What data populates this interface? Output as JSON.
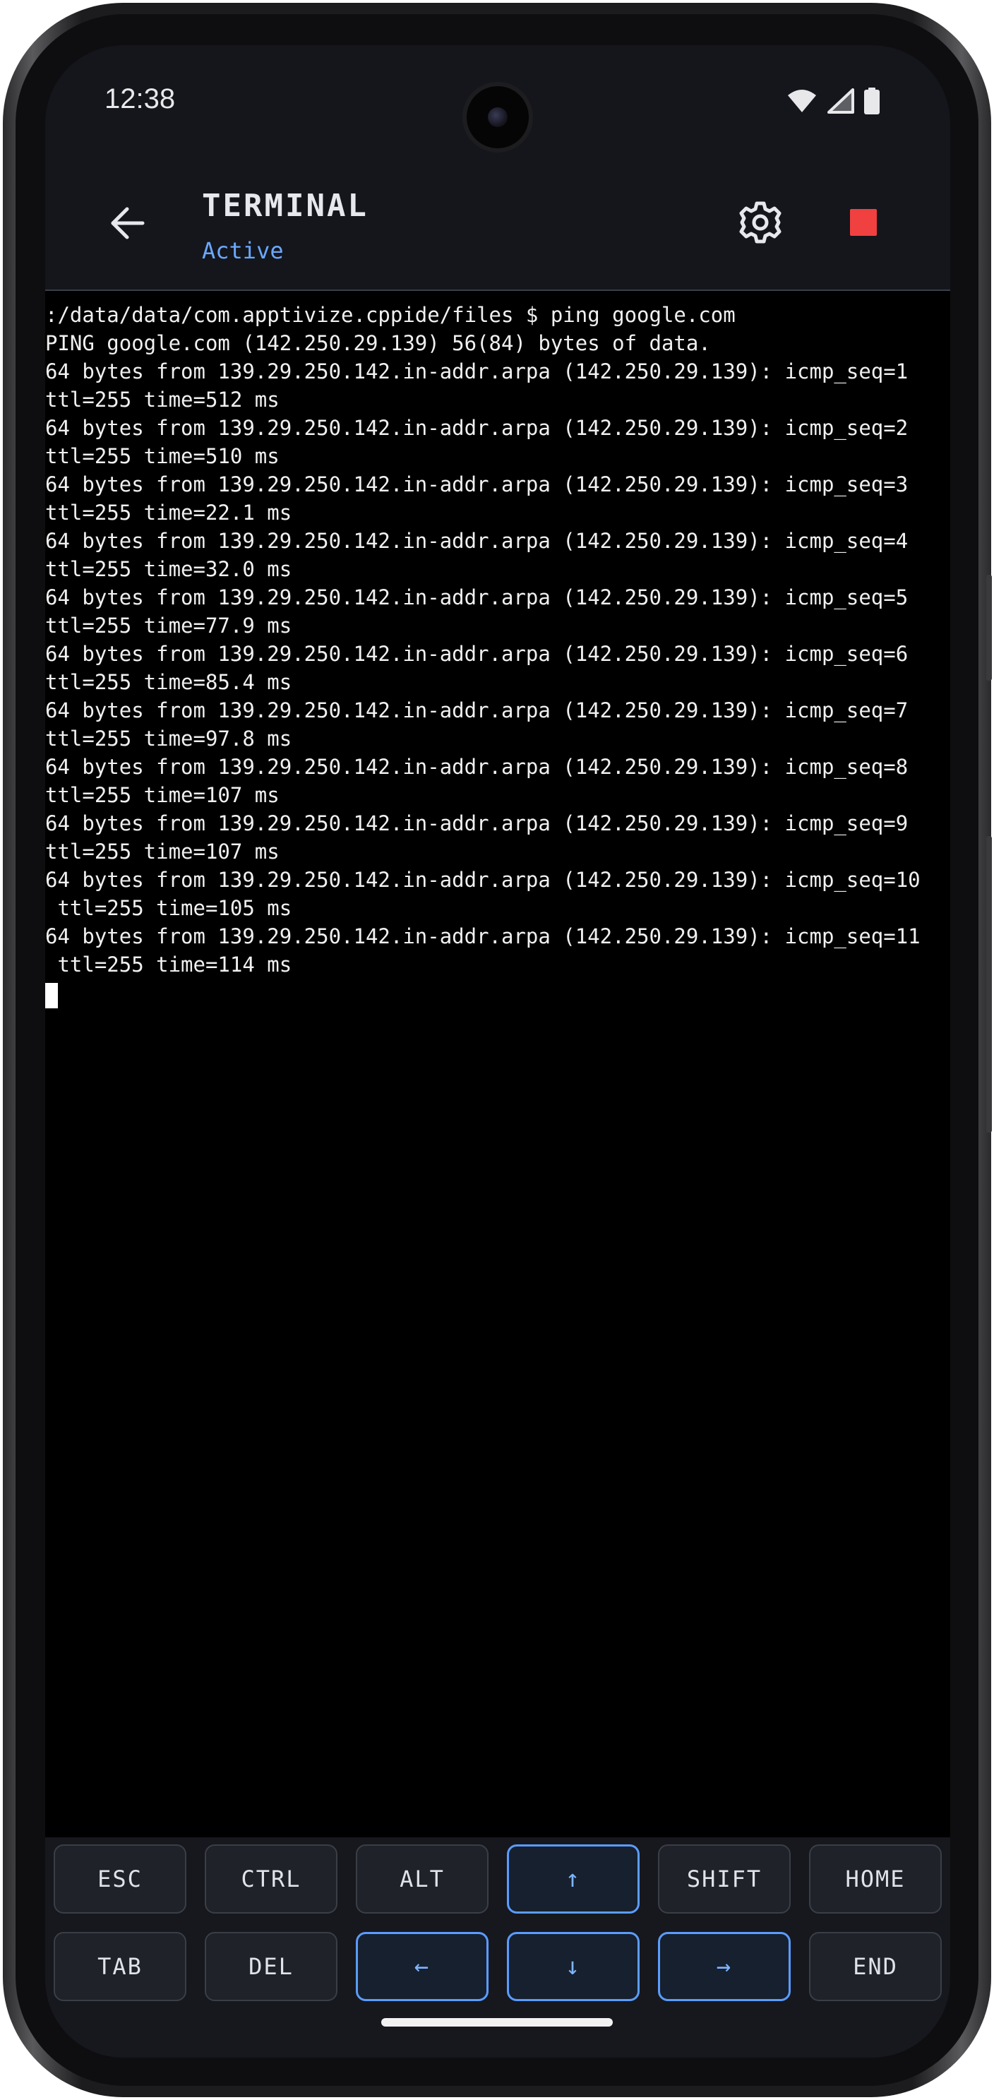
{
  "status_bar": {
    "time": "12:38"
  },
  "app_bar": {
    "title": "TERMINAL",
    "status": "Active",
    "status_color": "#6aa8ff",
    "stop_color": "#f04040"
  },
  "terminal": {
    "lines": [
      ":/data/data/com.apptivize.cppide/files $ ping google.com",
      "PING google.com (142.250.29.139) 56(84) bytes of data.",
      "64 bytes from 139.29.250.142.in-addr.arpa (142.250.29.139): icmp_seq=1",
      "ttl=255 time=512 ms",
      "64 bytes from 139.29.250.142.in-addr.arpa (142.250.29.139): icmp_seq=2",
      "ttl=255 time=510 ms",
      "64 bytes from 139.29.250.142.in-addr.arpa (142.250.29.139): icmp_seq=3",
      "ttl=255 time=22.1 ms",
      "64 bytes from 139.29.250.142.in-addr.arpa (142.250.29.139): icmp_seq=4",
      "ttl=255 time=32.0 ms",
      "64 bytes from 139.29.250.142.in-addr.arpa (142.250.29.139): icmp_seq=5",
      "ttl=255 time=77.9 ms",
      "64 bytes from 139.29.250.142.in-addr.arpa (142.250.29.139): icmp_seq=6",
      "ttl=255 time=85.4 ms",
      "64 bytes from 139.29.250.142.in-addr.arpa (142.250.29.139): icmp_seq=7",
      "ttl=255 time=97.8 ms",
      "64 bytes from 139.29.250.142.in-addr.arpa (142.250.29.139): icmp_seq=8",
      "ttl=255 time=107 ms",
      "64 bytes from 139.29.250.142.in-addr.arpa (142.250.29.139): icmp_seq=9",
      "ttl=255 time=107 ms",
      "64 bytes from 139.29.250.142.in-addr.arpa (142.250.29.139): icmp_seq=10",
      " ttl=255 time=105 ms",
      "64 bytes from 139.29.250.142.in-addr.arpa (142.250.29.139): icmp_seq=11",
      " ttl=255 time=114 ms"
    ]
  },
  "extra_keys": {
    "row1": [
      {
        "label": "ESC",
        "icon": ""
      },
      {
        "label": "CTRL",
        "icon": ""
      },
      {
        "label": "ALT",
        "icon": ""
      },
      {
        "label": "↑",
        "icon": "arrow-up-icon"
      },
      {
        "label": "SHIFT",
        "icon": ""
      },
      {
        "label": "HOME",
        "icon": ""
      }
    ],
    "row2": [
      {
        "label": "TAB",
        "icon": ""
      },
      {
        "label": "DEL",
        "icon": ""
      },
      {
        "label": "←",
        "icon": "arrow-left-icon"
      },
      {
        "label": "↓",
        "icon": "arrow-down-icon"
      },
      {
        "label": "→",
        "icon": "arrow-right-icon"
      },
      {
        "label": "END",
        "icon": ""
      }
    ],
    "arrow_accent": "#5b9cff"
  }
}
